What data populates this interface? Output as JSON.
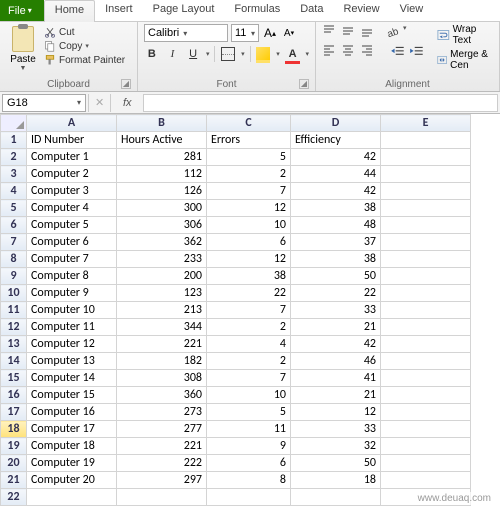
{
  "menu": {
    "file": "File",
    "tabs": [
      "Home",
      "Insert",
      "Page Layout",
      "Formulas",
      "Data",
      "Review",
      "View"
    ],
    "active": 0
  },
  "ribbon": {
    "clipboard": {
      "label": "Clipboard",
      "paste": "Paste",
      "cut": "Cut",
      "copy": "Copy",
      "format_painter": "Format Painter"
    },
    "font": {
      "label": "Font",
      "name": "Calibri",
      "size": "11"
    },
    "alignment": {
      "label": "Alignment",
      "wrap": "Wrap Text",
      "merge": "Merge & Cen"
    }
  },
  "namebox": "G18",
  "fx_label": "fx",
  "columns": [
    "A",
    "B",
    "C",
    "D",
    "E"
  ],
  "headers": [
    "ID Number",
    "Hours Active",
    "Errors",
    "Efficiency"
  ],
  "rows": [
    {
      "n": 1,
      "id": "",
      "hours": "",
      "errors": "",
      "eff": "",
      "is_header": true
    },
    {
      "n": 2,
      "id": "Computer 1",
      "hours": 281,
      "errors": 5,
      "eff": 42
    },
    {
      "n": 3,
      "id": "Computer 2",
      "hours": 112,
      "errors": 2,
      "eff": 44
    },
    {
      "n": 4,
      "id": "Computer 3",
      "hours": 126,
      "errors": 7,
      "eff": 42
    },
    {
      "n": 5,
      "id": "Computer 4",
      "hours": 300,
      "errors": 12,
      "eff": 38
    },
    {
      "n": 6,
      "id": "Computer 5",
      "hours": 306,
      "errors": 10,
      "eff": 48
    },
    {
      "n": 7,
      "id": "Computer 6",
      "hours": 362,
      "errors": 6,
      "eff": 37
    },
    {
      "n": 8,
      "id": "Computer 7",
      "hours": 233,
      "errors": 12,
      "eff": 38
    },
    {
      "n": 9,
      "id": "Computer 8",
      "hours": 200,
      "errors": 38,
      "eff": 50
    },
    {
      "n": 10,
      "id": "Computer 9",
      "hours": 123,
      "errors": 22,
      "eff": 22
    },
    {
      "n": 11,
      "id": "Computer 10",
      "hours": 213,
      "errors": 7,
      "eff": 33
    },
    {
      "n": 12,
      "id": "Computer 11",
      "hours": 344,
      "errors": 2,
      "eff": 21
    },
    {
      "n": 13,
      "id": "Computer 12",
      "hours": 221,
      "errors": 4,
      "eff": 42
    },
    {
      "n": 14,
      "id": "Computer 13",
      "hours": 182,
      "errors": 2,
      "eff": 46
    },
    {
      "n": 15,
      "id": "Computer 14",
      "hours": 308,
      "errors": 7,
      "eff": 41
    },
    {
      "n": 16,
      "id": "Computer 15",
      "hours": 360,
      "errors": 10,
      "eff": 21
    },
    {
      "n": 17,
      "id": "Computer 16",
      "hours": 273,
      "errors": 5,
      "eff": 12
    },
    {
      "n": 18,
      "id": "Computer 17",
      "hours": 277,
      "errors": 11,
      "eff": 33,
      "selected": true
    },
    {
      "n": 19,
      "id": "Computer 18",
      "hours": 221,
      "errors": 9,
      "eff": 32
    },
    {
      "n": 20,
      "id": "Computer 19",
      "hours": 222,
      "errors": 6,
      "eff": 50
    },
    {
      "n": 21,
      "id": "Computer 20",
      "hours": 297,
      "errors": 8,
      "eff": 18
    },
    {
      "n": 22,
      "id": "",
      "hours": "",
      "errors": "",
      "eff": ""
    }
  ],
  "watermark": "www.deuaq.com"
}
